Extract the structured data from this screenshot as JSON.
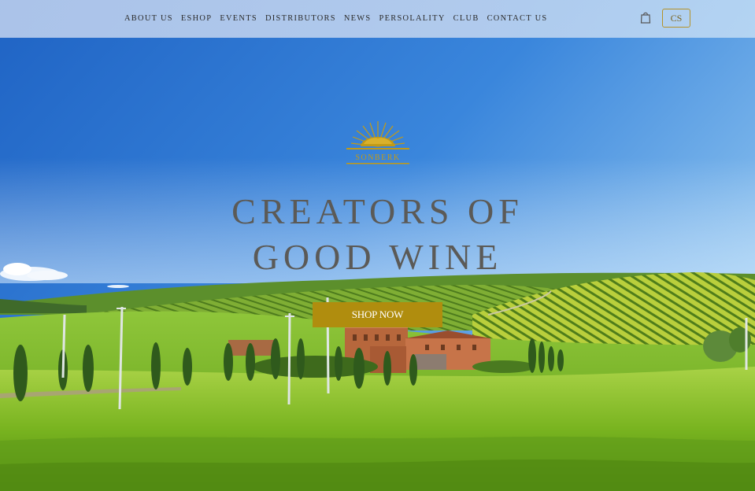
{
  "brand": {
    "logo_text": "SONBERK",
    "colors": {
      "gold": "#b08d0e",
      "gold_border": "#b4932a"
    }
  },
  "nav": {
    "items": [
      "ABOUT US",
      "ESHOP",
      "EVENTS",
      "DISTRIBUTORS",
      "NEWS",
      "PERSOLALITY",
      "CLUB",
      "CONTACT US"
    ],
    "cart_icon": "shopping-bag-icon",
    "language": "CS"
  },
  "hero": {
    "heading_line1": "CREATORS OF",
    "heading_line2": "GOOD WINE",
    "cta_label": "SHOP NOW"
  }
}
